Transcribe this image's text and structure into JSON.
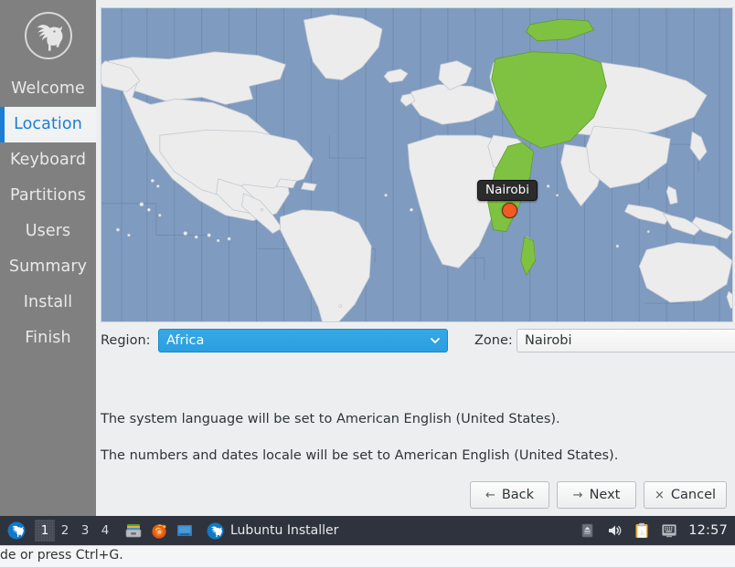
{
  "sidebar": {
    "logo_icon": "lubuntu-bird-logo",
    "items": [
      {
        "label": "Welcome",
        "active": false
      },
      {
        "label": "Location",
        "active": true
      },
      {
        "label": "Keyboard",
        "active": false
      },
      {
        "label": "Partitions",
        "active": false
      },
      {
        "label": "Users",
        "active": false
      },
      {
        "label": "Summary",
        "active": false
      },
      {
        "label": "Install",
        "active": false
      },
      {
        "label": "Finish",
        "active": false
      }
    ]
  },
  "map": {
    "selected_city": "Nairobi",
    "marker_color": "#f15a22",
    "ocean_color": "#7f9bc0",
    "land_color": "#ececed",
    "highlight_color": "#7fc241"
  },
  "form": {
    "region_label": "Region:",
    "region_value": "Africa",
    "zone_label": "Zone:",
    "zone_value": "Nairobi"
  },
  "locale": {
    "line1": "The system language will be set to American English (United States).",
    "line2": "The numbers and dates locale will be set to American English (United States)."
  },
  "buttons": {
    "back": {
      "label": "Back",
      "icon": "←"
    },
    "next": {
      "label": "Next",
      "icon": "→"
    },
    "cancel": {
      "label": "Cancel",
      "icon": "×"
    }
  },
  "taskbar": {
    "menu_icon": "lubuntu-menu-icon",
    "workspaces": [
      "1",
      "2",
      "3",
      "4"
    ],
    "active_workspace": "1",
    "launchers": [
      "file-manager-icon",
      "firefox-icon",
      "terminal-icon"
    ],
    "task": {
      "label": "Lubuntu Installer",
      "icon": "lubuntu-window-icon"
    },
    "tray": [
      "eject-icon",
      "volume-icon",
      "clipboard-icon",
      "display-icon"
    ],
    "clock": "12:57"
  },
  "statusbar": {
    "text": "de or press Ctrl+G."
  }
}
